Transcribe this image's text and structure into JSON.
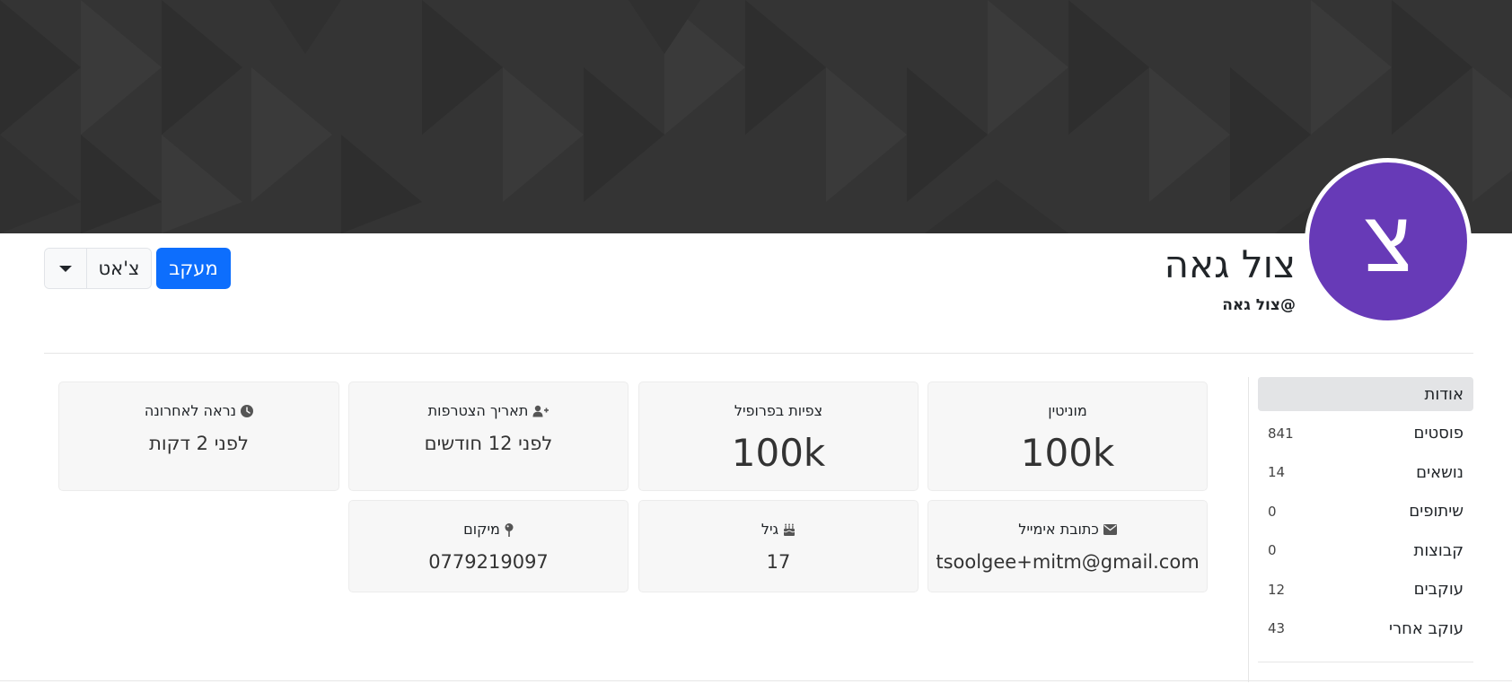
{
  "profile": {
    "avatar_letter": "צ",
    "avatar_color": "#673ab7",
    "fullname": "צול גאה",
    "username": "@צול גאה"
  },
  "actions": {
    "follow_label": "מעקב",
    "chat_label": "צ'אט",
    "follow_color": "#0d6efd"
  },
  "sidebar": {
    "items": [
      {
        "label": "אודות",
        "count": ""
      },
      {
        "label": "פוסטים",
        "count": "841"
      },
      {
        "label": "נושאים",
        "count": "14"
      },
      {
        "label": "שיתופים",
        "count": "0"
      },
      {
        "label": "קבוצות",
        "count": "0"
      },
      {
        "label": "עוקבים",
        "count": "12"
      },
      {
        "label": "עוקב אחרי",
        "count": "43"
      }
    ]
  },
  "stats": {
    "reputation": {
      "label": "מוניטין",
      "value": "100k"
    },
    "profile_views": {
      "label": "צפיות בפרופיל",
      "value": "100k"
    },
    "joined": {
      "label": "תאריך הצטרפות",
      "value": "לפני 12 חודשים",
      "icon": "user-plus-icon"
    },
    "last_seen": {
      "label": "נראה לאחרונה",
      "value": "לפני 2 דקות",
      "icon": "clock-icon"
    },
    "email": {
      "label": "כתובת אימייל",
      "value": "tsoolgee+mitm@gmail.com",
      "icon": "envelope-icon"
    },
    "age": {
      "label": "גיל",
      "value": "17",
      "icon": "birthday-cake-icon"
    },
    "location": {
      "label": "מיקום",
      "value": "0779219097",
      "icon": "map-pin-icon"
    }
  }
}
